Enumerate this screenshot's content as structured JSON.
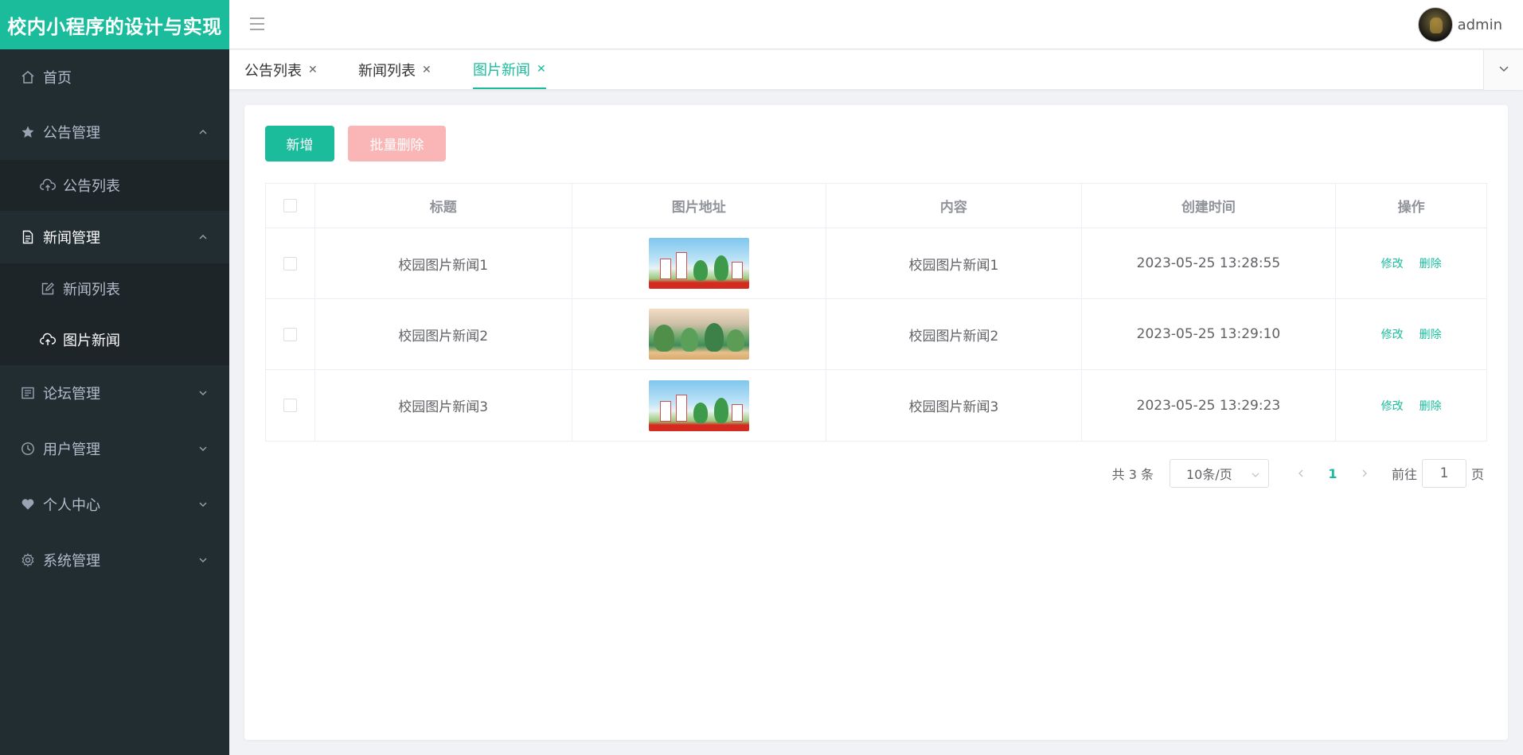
{
  "app": {
    "title": "校内小程序的设计与实现"
  },
  "header": {
    "username": "admin"
  },
  "sidebar": {
    "home": "首页",
    "notice": {
      "label": "公告管理",
      "items": [
        "公告列表"
      ]
    },
    "news": {
      "label": "新闻管理",
      "items": [
        "新闻列表",
        "图片新闻"
      ]
    },
    "forum": "论坛管理",
    "users": "用户管理",
    "profile": "个人中心",
    "system": "系统管理"
  },
  "tabs": [
    {
      "label": "公告列表"
    },
    {
      "label": "新闻列表"
    },
    {
      "label": "图片新闻"
    }
  ],
  "toolbar": {
    "add_label": "新增",
    "batch_delete_label": "批量删除"
  },
  "table": {
    "columns": [
      "标题",
      "图片地址",
      "内容",
      "创建时间",
      "操作"
    ],
    "rows": [
      {
        "title": "校园图片新闻1",
        "content": "校园图片新闻1",
        "created": "2023-05-25 13:28:55",
        "edit": "修改",
        "delete": "删除"
      },
      {
        "title": "校园图片新闻2",
        "content": "校园图片新闻2",
        "created": "2023-05-25 13:29:10",
        "edit": "修改",
        "delete": "删除"
      },
      {
        "title": "校园图片新闻3",
        "content": "校园图片新闻3",
        "created": "2023-05-25 13:29:23",
        "edit": "修改",
        "delete": "删除"
      }
    ]
  },
  "pagination": {
    "total": "共 3 条",
    "page_size": "10条/页",
    "current": "1",
    "goto_label": "前往",
    "goto_value": "1",
    "page_suffix": "页"
  },
  "colors": {
    "accent": "#1abc9c",
    "sidebar_bg": "#222d32",
    "danger_disabled": "#fab6b6"
  }
}
